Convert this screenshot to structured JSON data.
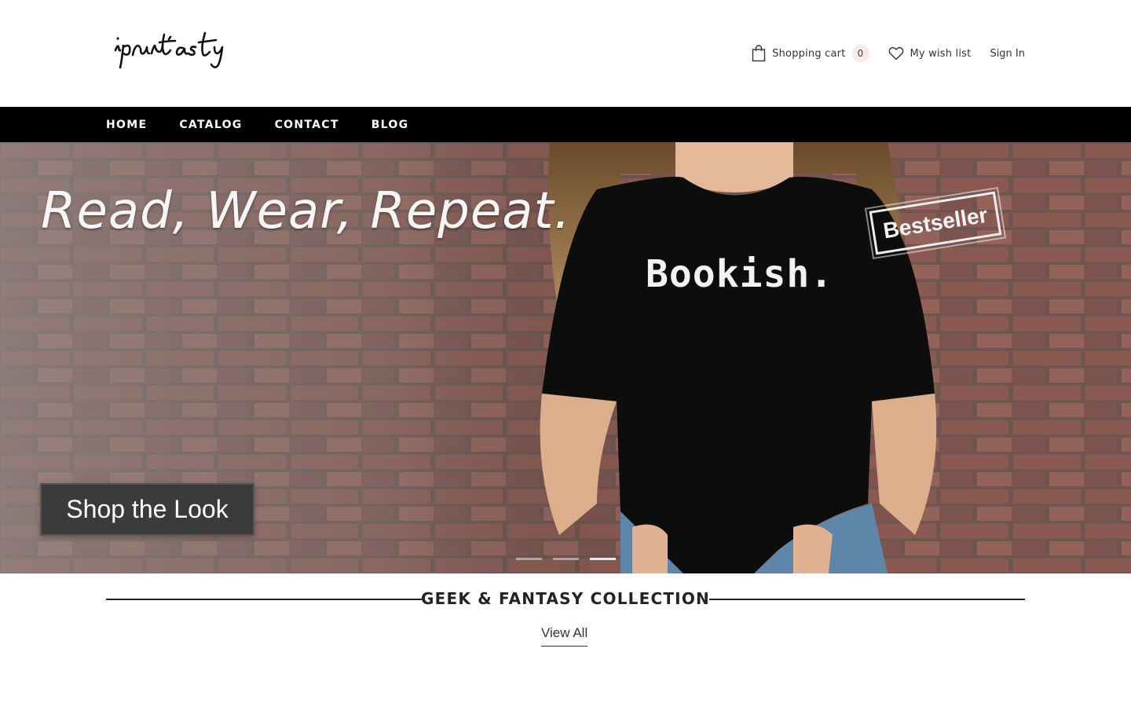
{
  "header": {
    "logo_text": "iprintasty",
    "cart_label": "Shopping cart",
    "cart_count": "0",
    "wishlist_label": "My wish list",
    "signin_label": "Sign In",
    "icons": [
      "shopping-bag-icon",
      "heart-icon"
    ]
  },
  "nav": {
    "items": [
      {
        "label": "HOME"
      },
      {
        "label": "CATALOG"
      },
      {
        "label": "CONTACT"
      },
      {
        "label": "BLOG"
      }
    ]
  },
  "hero": {
    "headline": "Read, Wear, Repeat.",
    "shirt_text": "Bookish.",
    "badge": "Bestseller",
    "cta_label": "Shop the Look",
    "slides_total": 3,
    "active_slide": 3
  },
  "section": {
    "title": "GEEK & FANTASY COLLECTION",
    "view_all_label": "View All"
  },
  "colors": {
    "nav_bg": "#000000",
    "cart_badge_bg": "#fde8e8",
    "text": "#222222"
  }
}
